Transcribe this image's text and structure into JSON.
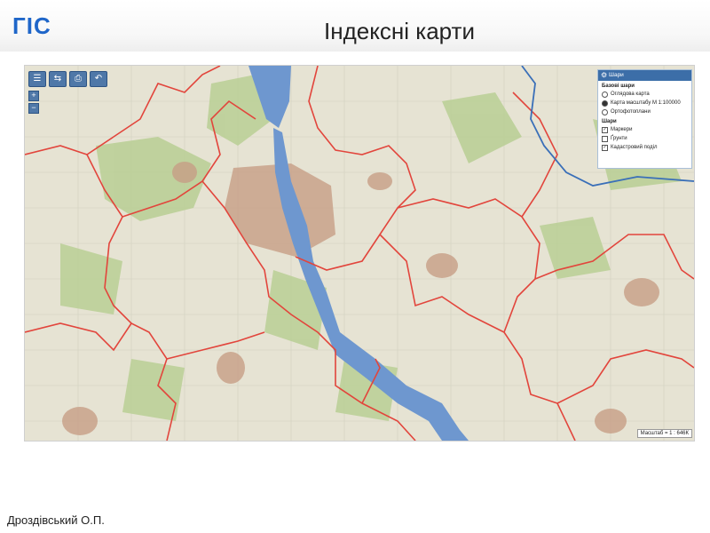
{
  "header": {
    "gis_label": "ГІС",
    "title": "Індексні карти"
  },
  "map": {
    "toolbar": {
      "layers_btn": "☰",
      "measure_btn": "⇆",
      "print_btn": "⎙",
      "back_btn": "↶"
    },
    "zoom": {
      "plus": "+",
      "minus": "−"
    },
    "layers_panel": {
      "title": "Шари",
      "base_section": "Базові шари",
      "base_options": [
        {
          "label": "Оглядова карта",
          "selected": false
        },
        {
          "label": "Карта масштабу М 1:100000",
          "selected": true
        },
        {
          "label": "Ортофотоплани",
          "selected": false
        }
      ],
      "layers_section": "Шари",
      "layer_options": [
        {
          "label": "Маркери",
          "checked": true
        },
        {
          "label": "Ґрунти",
          "checked": false
        },
        {
          "label": "Кадастровий поділ",
          "checked": true
        }
      ]
    },
    "scale_text": "Масштаб = 1 : 646К",
    "colors": {
      "boundary_red": "#e2453c",
      "boundary_blue": "#3a6fb8",
      "water": "#6e97cf",
      "urban": "#c79e86",
      "forest": "#b9cf94",
      "land": "#e6e3d3"
    }
  },
  "footer": {
    "author": "Дроздівський О.П."
  }
}
